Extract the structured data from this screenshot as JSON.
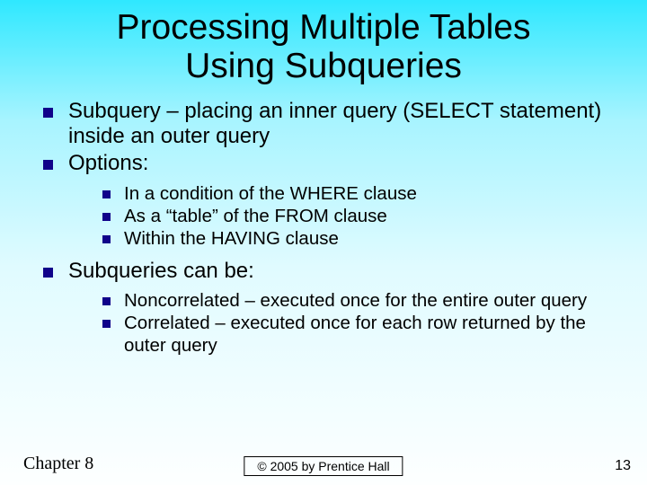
{
  "title_line1": "Processing Multiple Tables",
  "title_line2": "Using Subqueries",
  "bullets": {
    "b1": "Subquery – placing an inner query (SELECT statement) inside an outer query",
    "b2": "Options:",
    "b2_sub": {
      "s1": "In a condition of the WHERE clause",
      "s2": "As a “table” of the FROM clause",
      "s3": "Within the HAVING clause"
    },
    "b3": "Subqueries can be:",
    "b3_sub": {
      "s1": "Noncorrelated – executed once for the entire outer query",
      "s2": "Correlated – executed once for each row returned by the outer query"
    }
  },
  "footer": {
    "chapter": "Chapter 8",
    "copyright": "© 2005 by Prentice Hall",
    "page": "13"
  },
  "colors": {
    "bullet": "#10028a",
    "bg_top": "#2fe8ff",
    "bg_bottom": "#fdffff"
  }
}
